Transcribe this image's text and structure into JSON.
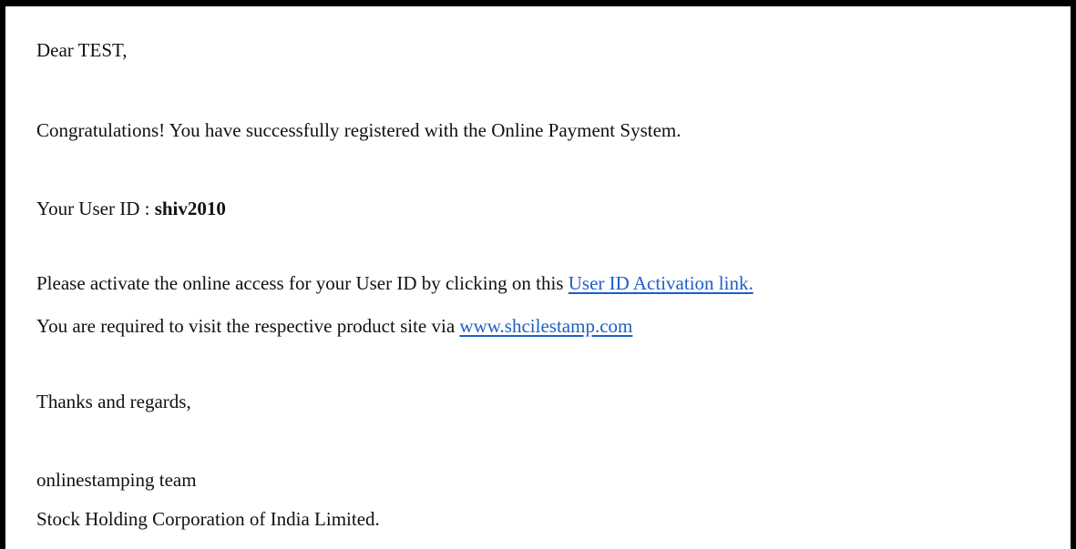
{
  "email": {
    "greeting": "Dear TEST,",
    "congratulations": "Congratulations! You have successfully registered with the Online Payment System.",
    "user_id_label": "Your User ID : ",
    "user_id_value": "shiv2010",
    "activation_prefix": "Please activate the online access for your User ID by clicking on this ",
    "activation_link_text": "User ID Activation link.",
    "site_prefix": "You are required to visit the respective product site via ",
    "site_link_text": "www.shcilestamp.com",
    "closing": "Thanks and regards,",
    "team": "onlinestamping team",
    "company": "Stock Holding Corporation of India Limited."
  },
  "colors": {
    "link": "#1f5fc7",
    "border": "#000000",
    "text": "#111111",
    "background": "#ffffff"
  }
}
